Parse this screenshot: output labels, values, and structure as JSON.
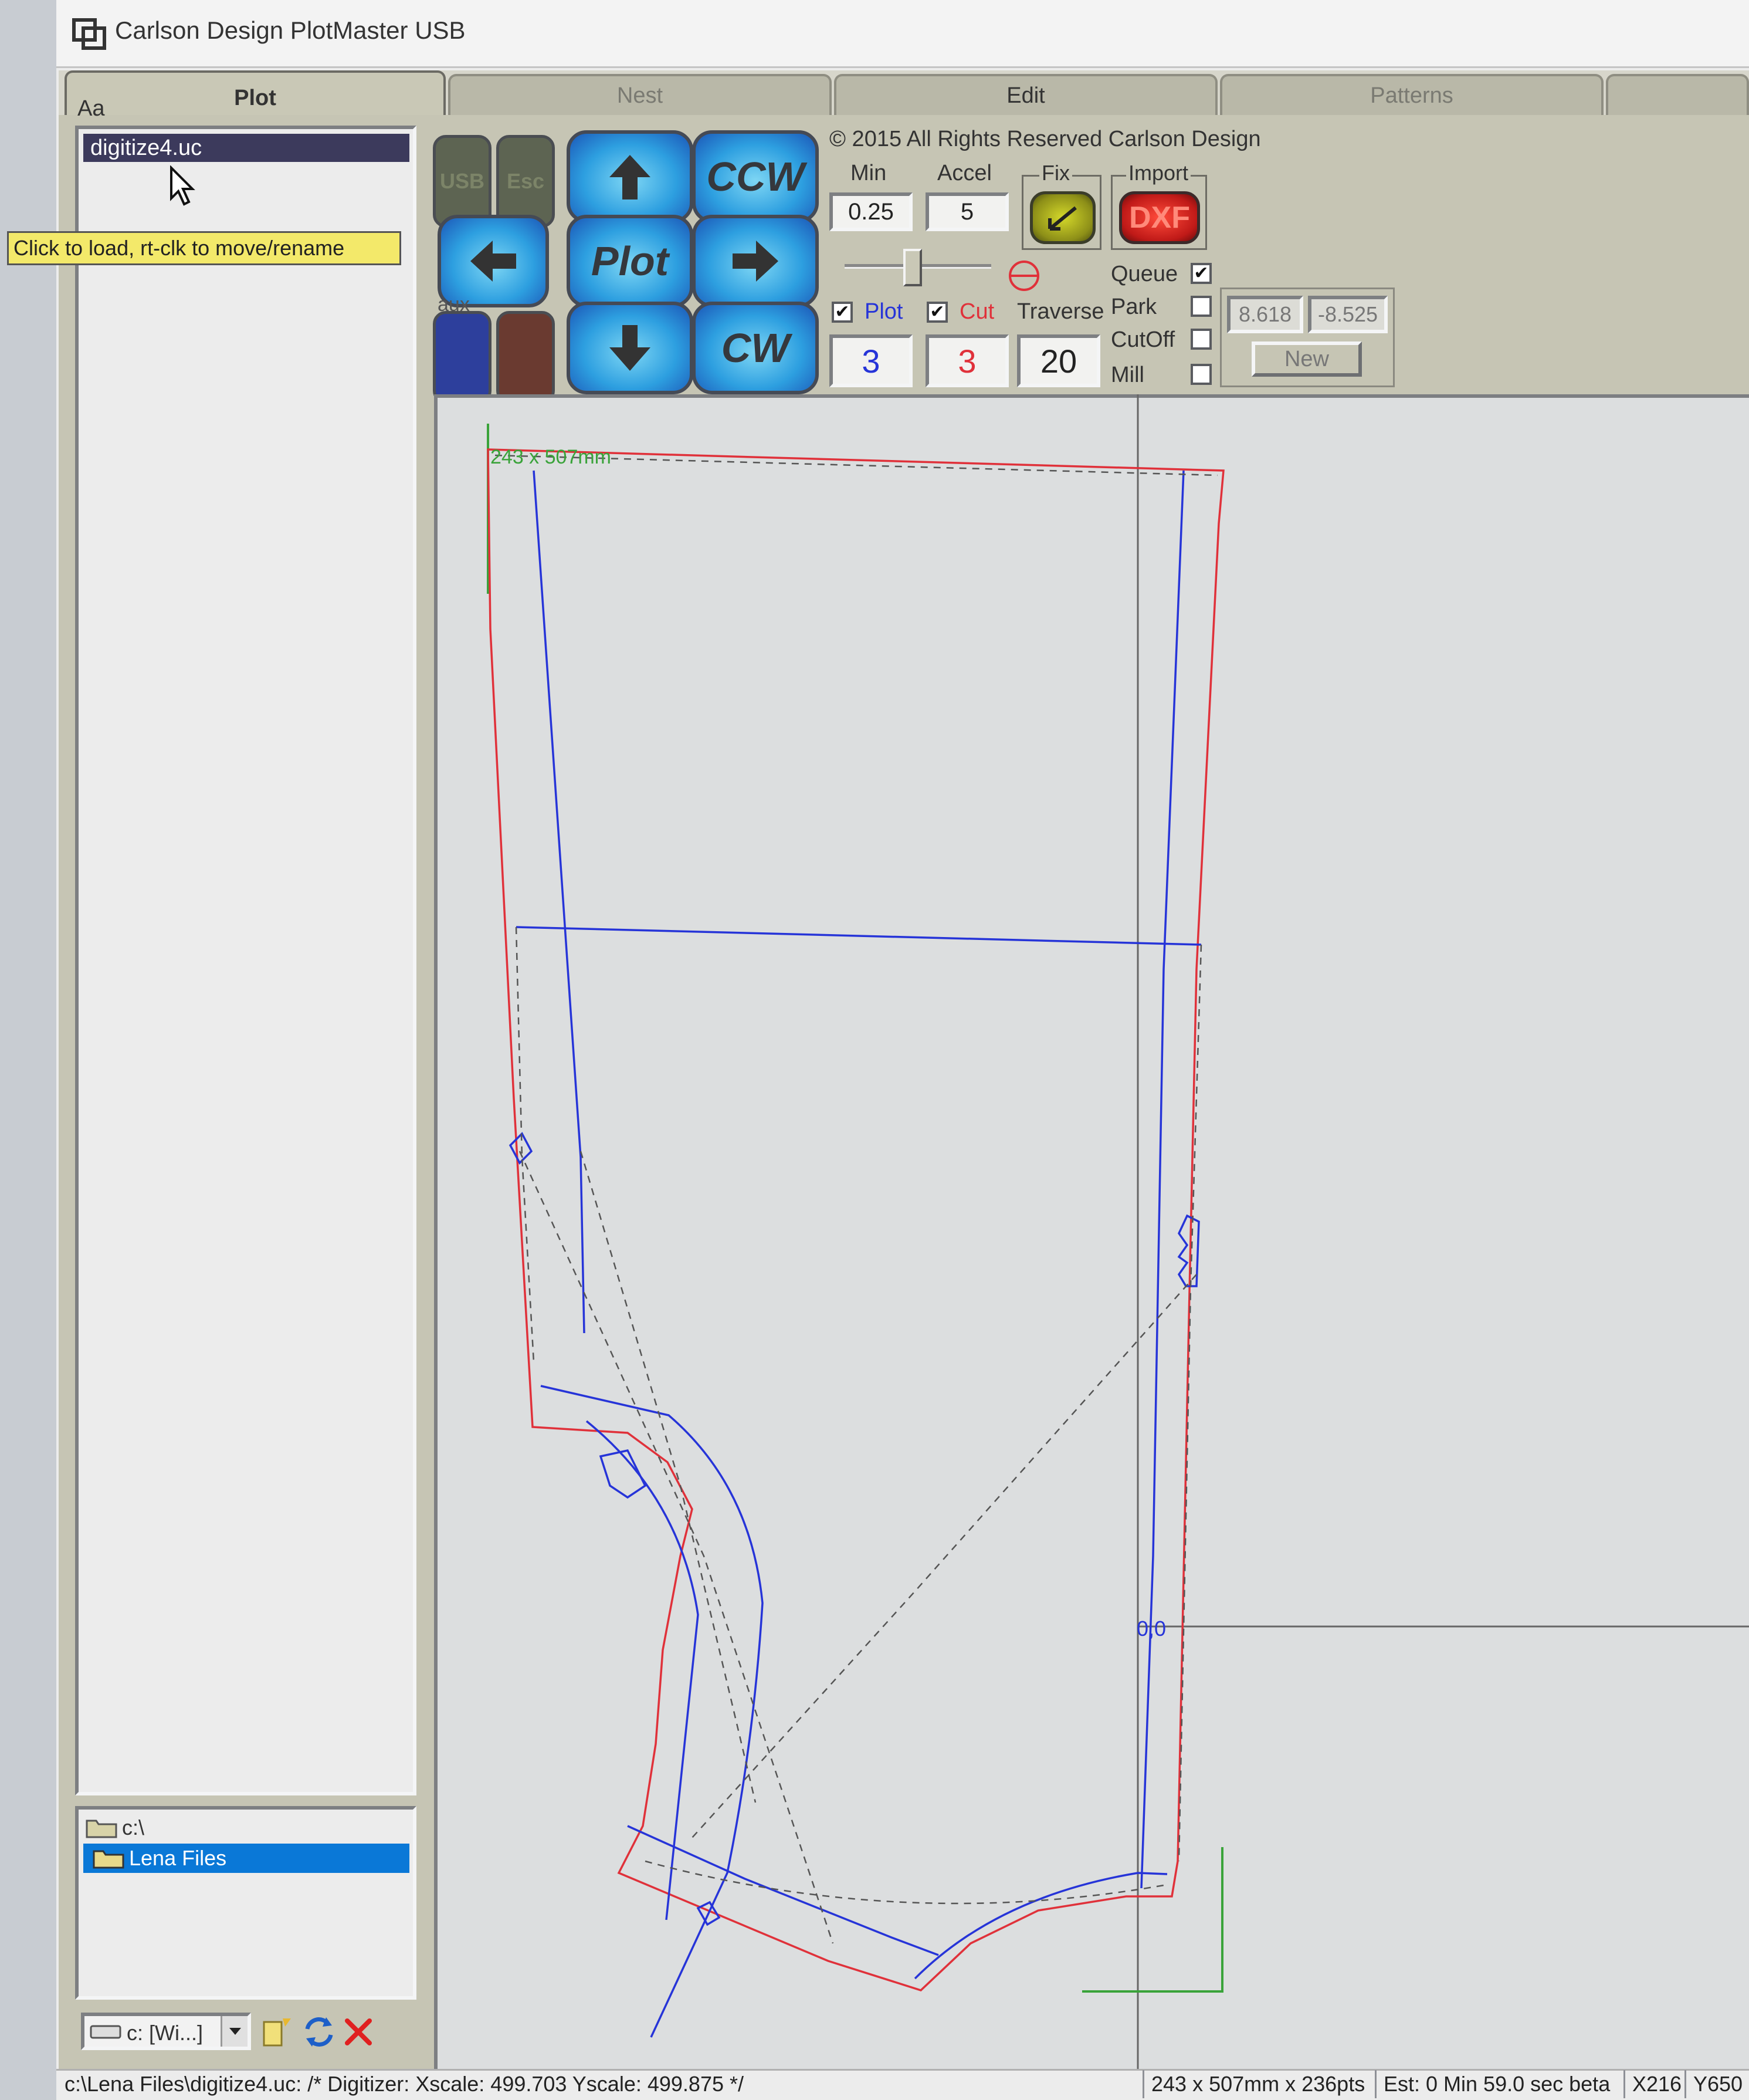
{
  "window": {
    "title": "Carlson Design PlotMaster USB"
  },
  "tabs": [
    {
      "label": "Plot",
      "active": true
    },
    {
      "label": "Nest"
    },
    {
      "label": "Edit"
    },
    {
      "label": "Patterns"
    }
  ],
  "left_panel": {
    "font_label": "Aa",
    "files": [
      "digitize4.uc"
    ],
    "tooltip": "Click to load, rt-clk to move/rename",
    "folders": [
      "c:\\",
      "Lena Files"
    ],
    "drive": "c: [Wi...]"
  },
  "controls": {
    "usb_label": "USB",
    "esc_label": "Esc",
    "ccw_label": "CCW",
    "plot_label": "Plot",
    "cw_label": "CW",
    "aux_label": "aux",
    "copyright": "© 2015 All Rights Reserved Carlson Design",
    "min_label": "Min",
    "min_value": "0.25",
    "accel_label": "Accel",
    "accel_value": "5",
    "fix_label": "Fix",
    "import_label": "Import",
    "dxf_label": "DXF",
    "plot_check_label": "Plot",
    "plot_checked": true,
    "cut_check_label": "Cut",
    "cut_checked": true,
    "traverse_label": "Traverse",
    "plot_speed": "3",
    "cut_speed": "3",
    "traverse_speed": "20",
    "queue_label": "Queue",
    "queue_checked": true,
    "park_label": "Park",
    "park_checked": false,
    "cutoff_label": "CutOff",
    "cutoff_checked": false,
    "mill_label": "Mill",
    "mill_checked": false,
    "coord_x": "8.618",
    "coord_y": "-8.525",
    "new_label": "New"
  },
  "canvas": {
    "size_label": "243 x 507mm",
    "origin_label": "0,0",
    "colors": {
      "cut": "#e0313a",
      "plot": "#2634d8",
      "guide": "#555555",
      "origin": "#3aa33a"
    }
  },
  "status_bar": {
    "path": "c:\\Lena Files\\digitize4.uc: /* Digitizer: Xscale: 499.703 Yscale: 499.875 */",
    "dimensions": "243 x 507mm x 236pts",
    "estimate": "Est:  0 Min 59.0 sec beta",
    "x_pos": "X216",
    "y_pos": "Y650"
  },
  "icons": [
    "app-logo-icon",
    "arrow-up-icon",
    "arrow-down-icon",
    "arrow-left-icon",
    "arrow-right-icon",
    "folder-icon",
    "drive-icon",
    "refresh-icon",
    "delete-icon",
    "mouse-cursor-icon"
  ]
}
